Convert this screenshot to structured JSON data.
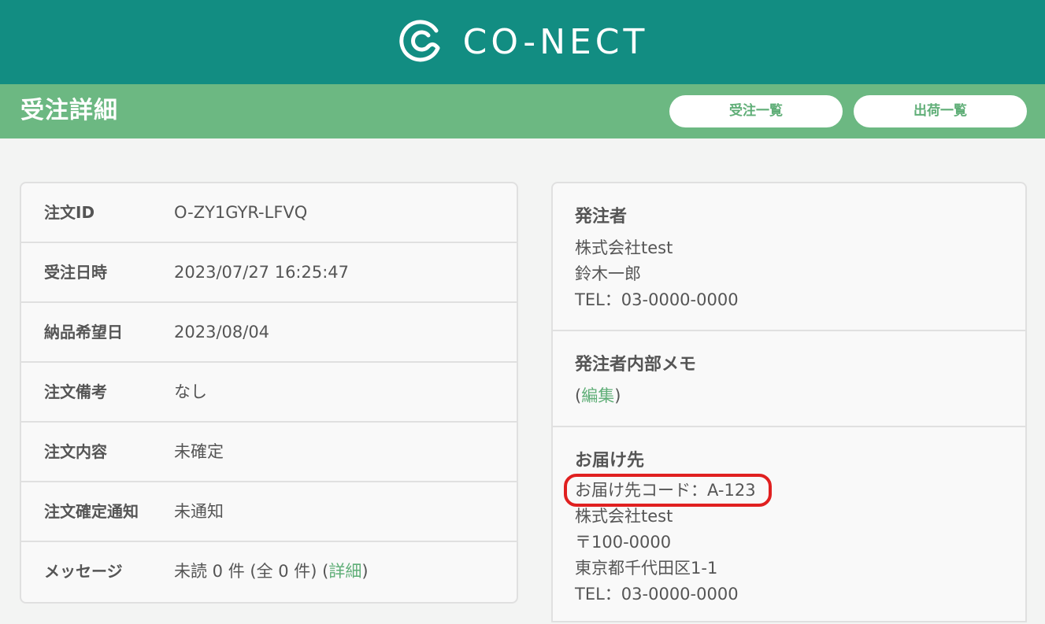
{
  "header": {
    "brand": "CO-NECT",
    "logo_icon": "conect-logo-icon"
  },
  "subheader": {
    "title": "受注詳細",
    "buttons": {
      "order_list": "受注一覧",
      "shipment_list": "出荷一覧"
    }
  },
  "order": {
    "rows": [
      {
        "label": "注文ID",
        "value": "O-ZY1GYR-LFVQ"
      },
      {
        "label": "受注日時",
        "value": "2023/07/27 16:25:47"
      },
      {
        "label": "納品希望日",
        "value": "2023/08/04"
      },
      {
        "label": "注文備考",
        "value": "なし"
      },
      {
        "label": "注文内容",
        "value": "未確定"
      },
      {
        "label": "注文確定通知",
        "value": "未通知"
      }
    ],
    "message": {
      "label": "メッセージ",
      "value_text": "未読 0 件 (全 0 件) (",
      "detail_link": "詳細",
      "close_paren": ")"
    }
  },
  "orderer": {
    "title": "発注者",
    "company": "株式会社test",
    "person": "鈴木一郎",
    "tel": "TEL：03-0000-0000"
  },
  "memo": {
    "title": "発注者内部メモ",
    "open_paren": "(",
    "edit_link": "編集",
    "close_paren": ")"
  },
  "delivery": {
    "title": "お届け先",
    "code": "お届け先コード：A-123",
    "company": "株式会社test",
    "postal": "〒100-0000",
    "address": "東京都千代田区1-1",
    "tel": "TEL：03-0000-0000"
  },
  "colors": {
    "header": "#128d82",
    "subheader": "#6cb882",
    "link": "#5fae77",
    "highlight": "#e02020"
  }
}
